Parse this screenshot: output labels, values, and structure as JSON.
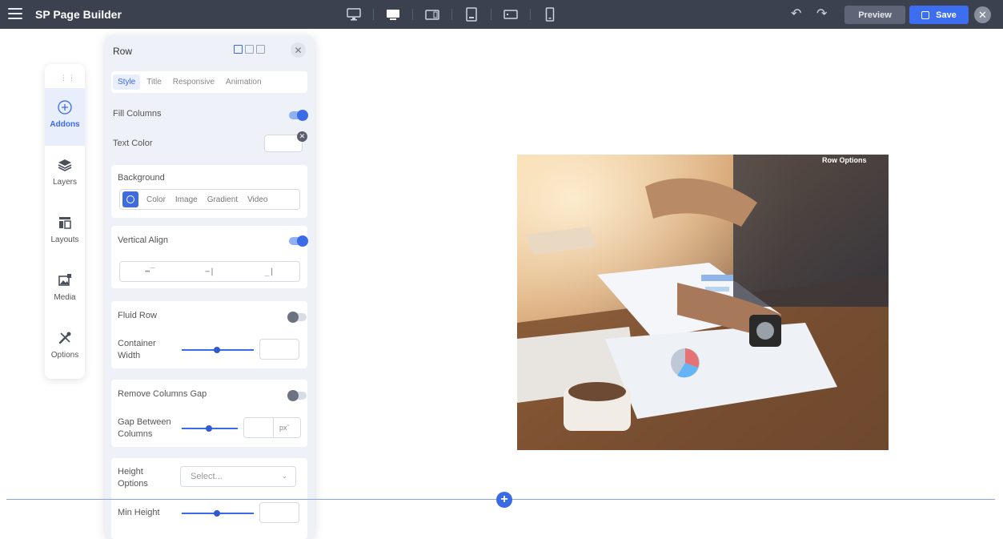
{
  "app": {
    "title": "SP Page Builder"
  },
  "toolbar": {
    "devices": [
      "desktop-large",
      "desktop",
      "tablet-landscape",
      "tablet",
      "mobile-landscape",
      "mobile"
    ],
    "preview_label": "Preview",
    "save_label": "Save"
  },
  "sidebar": {
    "items": [
      {
        "label": "Addons",
        "icon": "plus-circle-icon",
        "active": true
      },
      {
        "label": "Layers",
        "icon": "layers-icon"
      },
      {
        "label": "Layouts",
        "icon": "layout-icon"
      },
      {
        "label": "Media",
        "icon": "media-icon"
      },
      {
        "label": "Options",
        "icon": "tools-icon"
      }
    ]
  },
  "panel": {
    "title": "Row",
    "tabs": [
      "Style",
      "Title",
      "Responsive",
      "Animation"
    ],
    "active_tab": "Style",
    "fill_columns": {
      "label": "Fill Columns",
      "on": true
    },
    "text_color": {
      "label": "Text Color",
      "value": ""
    },
    "background": {
      "label": "Background",
      "options": [
        "Color",
        "Image",
        "Gradient",
        "Video"
      ]
    },
    "vertical_align": {
      "label": "Vertical Align",
      "on": true
    },
    "fluid_row": {
      "label": "Fluid Row",
      "on": false
    },
    "container_width": {
      "label_line1": "Container",
      "label_line2": "Width",
      "value": ""
    },
    "remove_columns_gap": {
      "label": "Remove Columns Gap",
      "on": false
    },
    "gap_between_columns": {
      "label_line1": "Gap Between",
      "label_line2": "Columns",
      "value": "",
      "unit": "px"
    },
    "height_options": {
      "label_line1": "Height",
      "label_line2": "Options",
      "placeholder": "Select..."
    },
    "min_height": {
      "label": "Min Height",
      "value": ""
    }
  },
  "canvas": {
    "row_options_label": "Row Options"
  },
  "colors": {
    "topbar": "#3c4150",
    "accent": "#3a6ae6",
    "panel_bg": "#eef1f8"
  }
}
